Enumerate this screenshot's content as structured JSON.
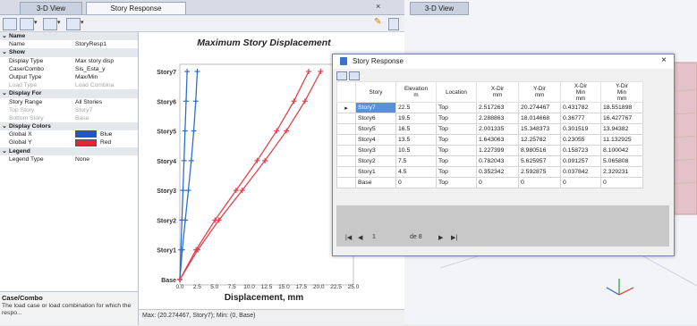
{
  "tabs": {
    "left_tab1": "3-D View",
    "left_tab2": "Story Response",
    "close": "× ",
    "right_tab": "3-D View"
  },
  "properties": [
    {
      "type": "cat",
      "toggle": "⌄",
      "key": "Name",
      "value": ""
    },
    {
      "type": "row",
      "key": "Name",
      "value": "StoryResp1"
    },
    {
      "type": "cat",
      "toggle": "⌄",
      "key": "Show",
      "value": ""
    },
    {
      "type": "row",
      "key": "Display Type",
      "value": "Max story disp"
    },
    {
      "type": "row",
      "key": "Case/Combo",
      "value": "Sis_Esta_y"
    },
    {
      "type": "row",
      "key": "Output Type",
      "value": "Max/Min"
    },
    {
      "type": "dim",
      "key": "Load Type",
      "value": "Load Combina"
    },
    {
      "type": "cat",
      "toggle": "⌄",
      "key": "Display For",
      "value": ""
    },
    {
      "type": "row",
      "key": "Story Range",
      "value": "All Stories"
    },
    {
      "type": "dim",
      "key": "Top Story",
      "value": "Story7"
    },
    {
      "type": "dim",
      "key": "Bottom Story",
      "value": "Base"
    },
    {
      "type": "cat",
      "toggle": "⌄",
      "key": "Display Colors",
      "value": ""
    },
    {
      "type": "color",
      "key": "Global X",
      "value": "Blue",
      "swatch": "#2255c9"
    },
    {
      "type": "color",
      "key": "Global Y",
      "value": "Red",
      "swatch": "#d92b35"
    },
    {
      "type": "cat",
      "toggle": "⌄",
      "key": "Legend",
      "value": ""
    },
    {
      "type": "row",
      "key": "Legend Type",
      "value": "None"
    }
  ],
  "description": {
    "title": "Case/Combo",
    "text": "The load case or load combination for which the respo..."
  },
  "status": "Max: (20.274467, Story7);  Min: (0, Base)",
  "chart_data": {
    "type": "line",
    "title": "Maximum Story Displacement",
    "xlabel": "Displacement, mm",
    "ylabel": "",
    "categories": [
      "Base",
      "Story1",
      "Story2",
      "Story3",
      "Story4",
      "Story5",
      "Story6",
      "Story7"
    ],
    "xticks": [
      "0.0",
      "2.5",
      "5.0",
      "7.5",
      "10.0",
      "12.5",
      "15.0",
      "17.5",
      "20.0",
      "22.5",
      "25.0"
    ],
    "xlim": [
      0,
      25
    ],
    "series": [
      {
        "color": "#2f6fcf",
        "values": [
          0,
          0.15,
          0.3,
          0.45,
          0.6,
          0.75,
          0.9,
          1.05
        ]
      },
      {
        "color": "#2f6fcf",
        "values": [
          0,
          0.352342,
          0.782043,
          1.227399,
          1.643063,
          2.001335,
          2.288863,
          2.517263
        ]
      },
      {
        "color": "#e0424c",
        "values": [
          0,
          2.329231,
          5.065808,
          8.100042,
          11.132925,
          13.94382,
          16.427767,
          18.551898
        ]
      },
      {
        "color": "#e0424c",
        "values": [
          0,
          2.592875,
          5.625957,
          8.980516,
          12.25782,
          15.348373,
          18.014668,
          20.274467
        ]
      }
    ]
  },
  "dialog": {
    "title": "Story Response",
    "close": "×",
    "headers": [
      "Story",
      "Elevation\nm",
      "Location",
      "X-Dir\nmm",
      "Y-Dir\nmm",
      "X-Dir\nMin\nmm",
      "Y-Dir\nMin\nmm"
    ],
    "rows": [
      [
        "Story7",
        "22.5",
        "Top",
        "2.517263",
        "20.274467",
        "0.431782",
        "18.551898"
      ],
      [
        "Story6",
        "19.5",
        "Top",
        "2.288863",
        "18.014668",
        "0.36777",
        "16.427767"
      ],
      [
        "Story5",
        "16.5",
        "Top",
        "2.001335",
        "15.348373",
        "0.301519",
        "13.94382"
      ],
      [
        "Story4",
        "13.5",
        "Top",
        "1.643063",
        "12.25782",
        "0.23055",
        "11.132925"
      ],
      [
        "Story3",
        "10.5",
        "Top",
        "1.227399",
        "8.980516",
        "0.158723",
        "8.100042"
      ],
      [
        "Story2",
        "7.5",
        "Top",
        "0.782043",
        "5.625957",
        "0.091257",
        "5.065808"
      ],
      [
        "Story1",
        "4.5",
        "Top",
        "0.352342",
        "2.592875",
        "0.037842",
        "2.329231"
      ],
      [
        "Base",
        "0",
        "Top",
        "0",
        "0",
        "0",
        "0"
      ]
    ],
    "pager": {
      "first": "|◀",
      "prev": "◀",
      "page": "1",
      "of": "de 8",
      "next": "▶",
      "last": "▶|"
    }
  }
}
